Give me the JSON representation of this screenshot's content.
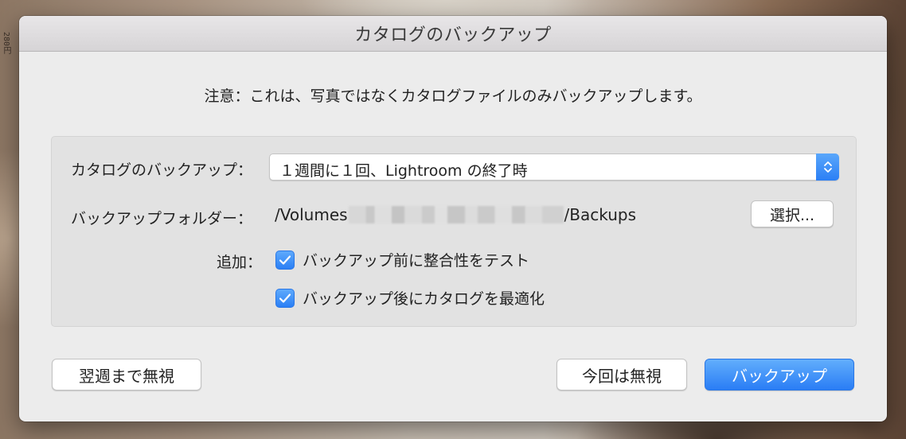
{
  "dialog": {
    "title": "カタログのバックアップ",
    "notice": "注意：これは、写真ではなくカタログファイルのみバックアップします。"
  },
  "settings": {
    "backup_label": "カタログのバックアップ：",
    "backup_frequency": "１週間に１回、Lightroom の終了時",
    "folder_label": "バックアップフォルダー：",
    "folder_path_start": "/Volumes",
    "folder_path_end": "/Backups",
    "choose_button": "選択...",
    "also_label": "追加：",
    "options": [
      {
        "label": "バックアップ前に整合性をテスト",
        "checked": true
      },
      {
        "label": "バックアップ後にカタログを最適化",
        "checked": true
      }
    ]
  },
  "buttons": {
    "skip_until_next_week": "翌週まで無視",
    "skip_this_time": "今回は無視",
    "backup": "バックアップ"
  },
  "colors": {
    "accent": "#2b7ff5",
    "dialog_bg": "#ececec",
    "panel_bg": "#e2e2e2"
  },
  "icons": {
    "popup_arrows": "chevron-up-down-icon",
    "checkmark": "checkmark-icon"
  }
}
